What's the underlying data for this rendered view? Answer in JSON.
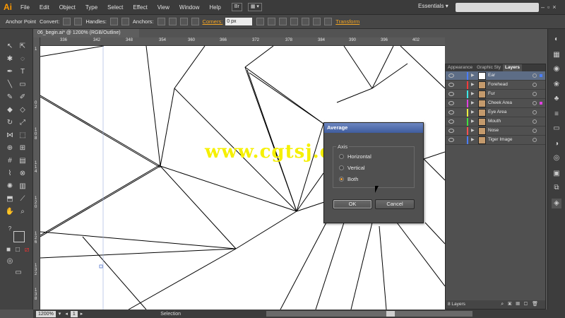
{
  "app": {
    "logo": "Ai"
  },
  "menu": [
    "File",
    "Edit",
    "Object",
    "Type",
    "Select",
    "Effect",
    "View",
    "Window",
    "Help"
  ],
  "menubar_extra": {
    "bridge": "Br",
    "workspace": "Essentials",
    "workspace_arrow": "▾"
  },
  "control_bar": {
    "anchor_point": "Anchor Point",
    "convert": "Convert:",
    "handles": "Handles:",
    "anchors": "Anchors:",
    "corners": "Corners:",
    "corners_value": "0 px",
    "transform": "Transform"
  },
  "document": {
    "tab_title": "06_begin.ai* @ 1200% (RGB/Outline)"
  },
  "ruler_top": [
    "336",
    "342",
    "348",
    "354",
    "360",
    "366",
    "372",
    "378",
    "384",
    "390",
    "396",
    "402"
  ],
  "ruler_left": [
    "1",
    "0 2",
    "1 0 8",
    "1 1 4",
    "1 2 0",
    "1 2 6",
    "1 3 2",
    "1 3 8"
  ],
  "status": {
    "zoom": "1200%",
    "artboard": "1",
    "mode": "Selection"
  },
  "layers_panel": {
    "tabs": [
      "Appearance",
      "Graphic Sty",
      "Layers"
    ],
    "layers": [
      {
        "name": "Ear",
        "color": "#4a7dff"
      },
      {
        "name": "Forehead",
        "color": "#ff3b3b"
      },
      {
        "name": "Fur",
        "color": "#3be8e8"
      },
      {
        "name": "Cheek Area",
        "color": "#e040e0"
      },
      {
        "name": "Eye Area",
        "color": "#f0f040"
      },
      {
        "name": "Mouth",
        "color": "#40e040"
      },
      {
        "name": "Nose",
        "color": "#ff5050"
      },
      {
        "name": "Tiger Image",
        "color": "#4a7dff"
      }
    ],
    "footer": "8 Layers"
  },
  "dialog": {
    "title": "Average",
    "group_label": "Axis",
    "options": [
      "Horizontal",
      "Vertical",
      "Both"
    ],
    "selected": "Both",
    "ok": "OK",
    "cancel": "Cancel"
  },
  "watermark": "www.cgtsj.com"
}
